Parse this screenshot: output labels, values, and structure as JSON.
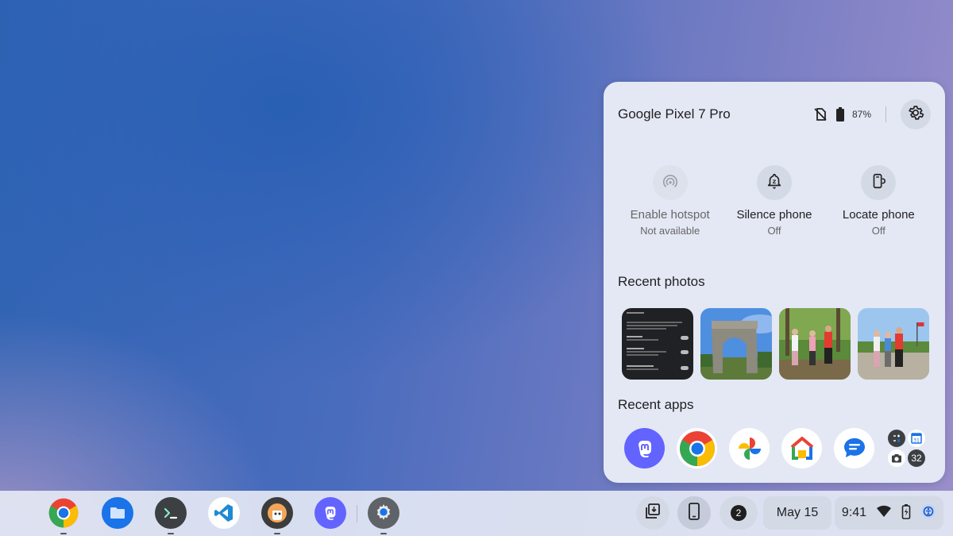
{
  "phone_hub": {
    "device_name": "Google Pixel 7 Pro",
    "battery_percent": "87%",
    "status_icons": [
      "no-sim-icon",
      "battery-icon"
    ],
    "settings_icon": "gear-icon",
    "actions": [
      {
        "label": "Enable hotspot",
        "status": "Not available",
        "icon": "hotspot-icon",
        "enabled": false
      },
      {
        "label": "Silence phone",
        "status": "Off",
        "icon": "silence-bell-icon",
        "enabled": true
      },
      {
        "label": "Locate phone",
        "status": "Off",
        "icon": "locate-phone-icon",
        "enabled": true
      }
    ],
    "recent_photos_title": "Recent photos",
    "recent_apps_title": "Recent apps",
    "recent_apps": [
      "mastodon",
      "chrome",
      "google-photos",
      "google-home",
      "messages"
    ],
    "more_apps_count": "32"
  },
  "shelf": {
    "apps": [
      "chrome",
      "files",
      "terminal",
      "vs-code",
      "app-5",
      "mastodon",
      "settings"
    ],
    "notification_count": "2",
    "date": "May 15",
    "time": "9:41"
  },
  "colors": {
    "panel_bg": "#e4e8f4",
    "button_bg": "#d4d9e6",
    "mastodon": "#6364ff",
    "chrome_red": "#ea4335",
    "chrome_yellow": "#fbbc04",
    "chrome_green": "#34a853",
    "chrome_blue": "#1a73e8"
  }
}
